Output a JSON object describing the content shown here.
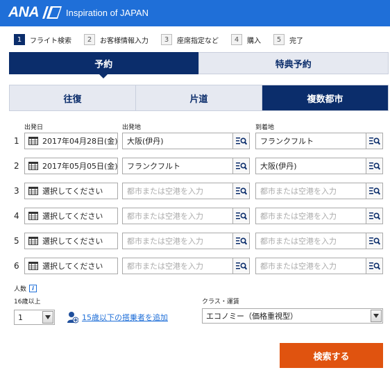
{
  "header": {
    "logo": "ANA",
    "tagline": "Inspiration of JAPAN",
    "color": "#1f6fd8"
  },
  "steps": [
    {
      "num": "1",
      "label": "フライト検索",
      "active": true
    },
    {
      "num": "2",
      "label": "お客様情報入力",
      "active": false
    },
    {
      "num": "3",
      "label": "座席指定など",
      "active": false
    },
    {
      "num": "4",
      "label": "購入",
      "active": false
    },
    {
      "num": "5",
      "label": "完了",
      "active": false
    }
  ],
  "main_tabs": [
    {
      "label": "予約",
      "active": true
    },
    {
      "label": "特典予約",
      "active": false
    }
  ],
  "trip_tabs": [
    {
      "label": "往復",
      "active": false
    },
    {
      "label": "片道",
      "active": false
    },
    {
      "label": "複数都市",
      "active": true
    }
  ],
  "columns": {
    "date": "出発日",
    "origin": "出発地",
    "destination": "到着地"
  },
  "city_placeholder": "都市または空港を入力",
  "segments": [
    {
      "num": "1",
      "date": "2017年04月28日(金)",
      "origin": "大阪(伊丹)",
      "destination": "フランクフルト"
    },
    {
      "num": "2",
      "date": "2017年05月05日(金)",
      "origin": "フランクフルト",
      "destination": "大阪(伊丹)"
    },
    {
      "num": "3",
      "date": "選択してください",
      "origin": "",
      "destination": ""
    },
    {
      "num": "4",
      "date": "選択してください",
      "origin": "",
      "destination": ""
    },
    {
      "num": "5",
      "date": "選択してください",
      "origin": "",
      "destination": ""
    },
    {
      "num": "6",
      "date": "選択してください",
      "origin": "",
      "destination": ""
    }
  ],
  "passengers": {
    "label": "人数",
    "info_icon": "i",
    "age_label": "16歳以上",
    "adults_value": "1",
    "add_child_link": "15歳以下の搭乗者を追加"
  },
  "cabin": {
    "label": "クラス・運賃",
    "value": "エコノミー（価格重視型）"
  },
  "search_button": "検索する",
  "colors": {
    "navy": "#0b2d6b",
    "accent": "#e0530f",
    "tab_bg": "#e6e9f1"
  }
}
